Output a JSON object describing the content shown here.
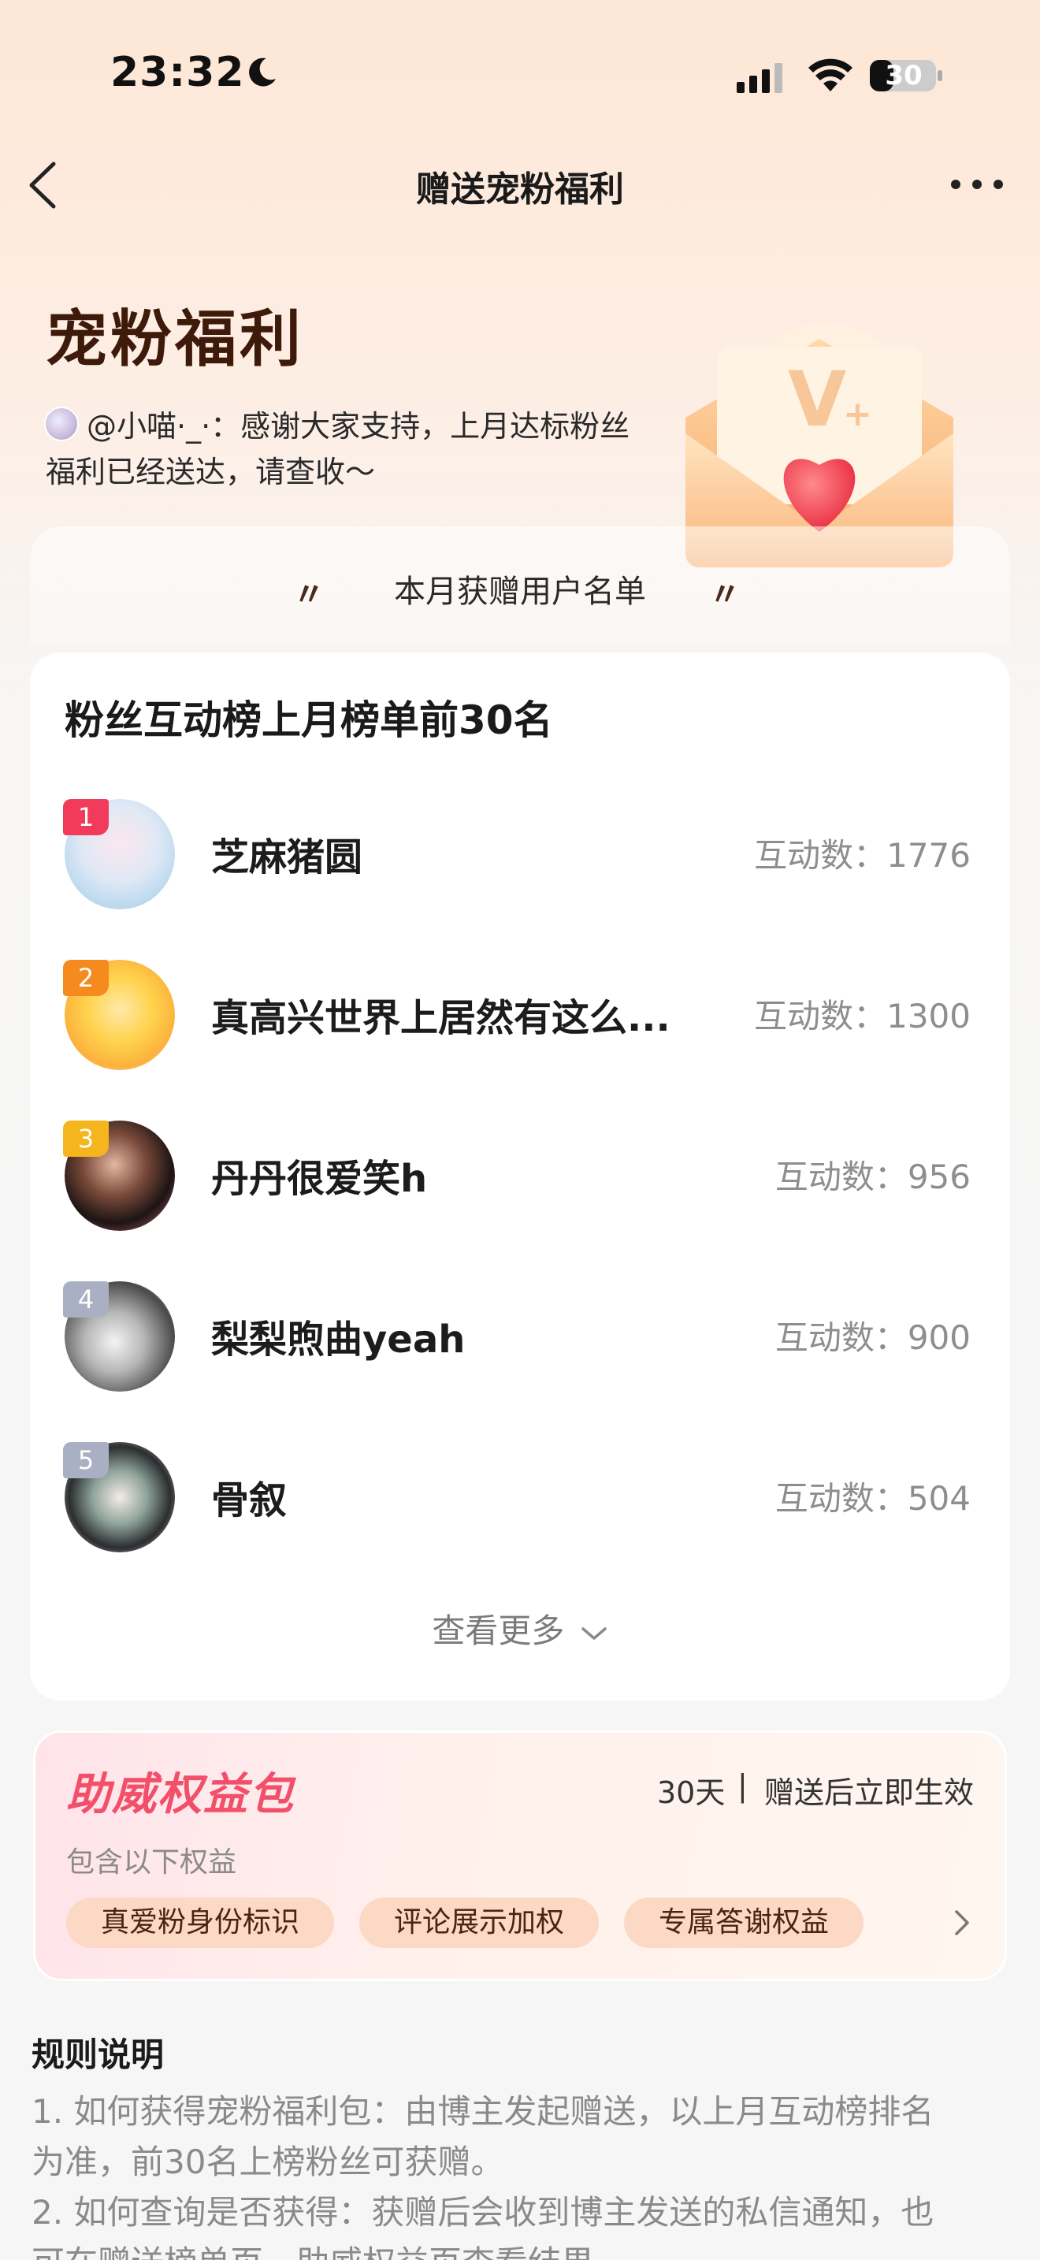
{
  "status_bar": {
    "time": "23:32",
    "battery": "30"
  },
  "nav": {
    "title": "赠送宠粉福利"
  },
  "hero": {
    "title": "宠粉福利",
    "message_line1": "@小喵·_·：感谢大家支持，上月达标粉丝",
    "message_line2": "福利已经送达，请查收～"
  },
  "list_header": {
    "label": "本月获赠用户名单",
    "quote_left": "〃",
    "quote_right": "〃"
  },
  "leaderboard": {
    "title": "粉丝互动榜上月榜单前30名",
    "rows": [
      {
        "rank": "1",
        "name": "芝麻猪圆",
        "score": "互动数：1776",
        "rank_color": "#f23a5b"
      },
      {
        "rank": "2",
        "name": "真高兴世界上居然有这么...",
        "score": "互动数：1300",
        "rank_color": "#f58a1f"
      },
      {
        "rank": "3",
        "name": "丹丹很爱笑h",
        "score": "互动数：956",
        "rank_color": "#f5b51c"
      },
      {
        "rank": "4",
        "name": "梨梨煦曲yeah",
        "score": "互动数：900",
        "rank_color": "#a9b0c3"
      },
      {
        "rank": "5",
        "name": "骨叙",
        "score": "互动数：504",
        "rank_color": "#a9b0c3"
      }
    ],
    "see_more": "查看更多"
  },
  "benefit": {
    "title": "助威权益包",
    "days": "30天",
    "separator": "|",
    "effect": "赠送后立即生效",
    "subtitle": "包含以下权益",
    "chips": [
      "真爱粉身份标识",
      "评论展示加权",
      "专属答谢权益"
    ]
  },
  "rules": {
    "title": "规则说明",
    "items": [
      "1. 如何获得宠粉福利包：由博主发起赠送，以上月互动榜排名",
      "为准，前30名上榜粉丝可获赠。",
      "2. 如何查询是否获得：获赠后会收到博主发送的私信通知，也",
      "可在赠送榜单页、助威权益页查看结果。"
    ]
  },
  "colors": {
    "accent": "#f2506a",
    "chip_bg": "#fcd9c4"
  }
}
